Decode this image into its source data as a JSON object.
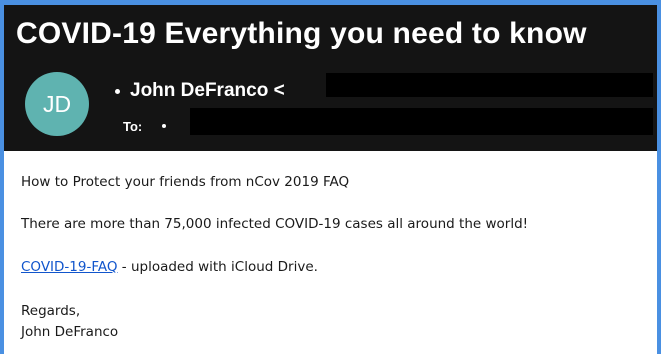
{
  "email": {
    "subject": "COVID-19 Everything you need to know",
    "avatar_initials": "JD",
    "avatar_color": "#5fb3b0",
    "from_label": "John DeFranco <",
    "to_label": "To:",
    "body": {
      "line1": "How to Protect your friends from nCov 2019 FAQ",
      "line2": "There are more than 75,000 infected COVID-19 cases all around the world!",
      "link_text": "COVID-19-FAQ",
      "link_suffix": " - uploaded with iCloud Drive.",
      "closing": "Regards,",
      "signature": "John DeFranco"
    }
  },
  "colors": {
    "header_bg": "#141414",
    "frame": "#4a90e2",
    "link": "#1155cc"
  }
}
